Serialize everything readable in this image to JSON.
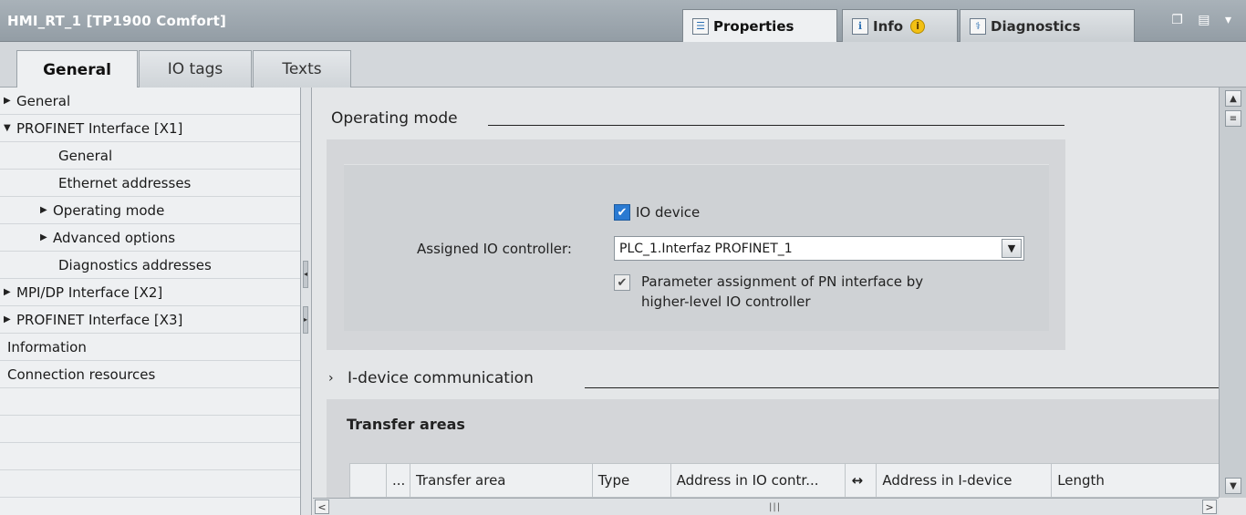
{
  "window": {
    "title": "HMI_RT_1 [TP1900 Comfort]",
    "controls": "❐ ▤ ▾"
  },
  "panel_tabs": [
    {
      "label": "Properties",
      "icon": "properties-icon",
      "glyph": "☰"
    },
    {
      "label": "Info",
      "icon": "info-list-icon",
      "glyph": "ℹ",
      "badge": "i"
    },
    {
      "label": "Diagnostics",
      "icon": "diagnostics-icon",
      "glyph": "⚕"
    }
  ],
  "subtabs": [
    "General",
    "IO tags",
    "Texts"
  ],
  "tree": [
    {
      "label": "General",
      "arrow": "▶",
      "indent": 0
    },
    {
      "label": "PROFINET Interface [X1]",
      "arrow": "▼",
      "indent": 0
    },
    {
      "label": "General",
      "arrow": "",
      "indent": 2
    },
    {
      "label": "Ethernet addresses",
      "arrow": "",
      "indent": 2
    },
    {
      "label": "Operating mode",
      "arrow": "▶",
      "indent": 1
    },
    {
      "label": "Advanced options",
      "arrow": "▶",
      "indent": 1
    },
    {
      "label": "Diagnostics addresses",
      "arrow": "",
      "indent": 2
    },
    {
      "label": "MPI/DP Interface [X2]",
      "arrow": "▶",
      "indent": 0
    },
    {
      "label": "PROFINET Interface [X3]",
      "arrow": "▶",
      "indent": 0
    },
    {
      "label": "Information",
      "arrow": "",
      "indent": 0
    },
    {
      "label": "Connection resources",
      "arrow": "",
      "indent": 0
    }
  ],
  "operating_mode": {
    "title": "Operating mode",
    "io_device_label": "IO device",
    "io_device_checked": true,
    "assigned_controller_label": "Assigned IO controller:",
    "assigned_controller_value": "PLC_1.Interfaz PROFINET_1",
    "param_assignment_line1": "Parameter assignment of PN interface by",
    "param_assignment_line2": "higher-level IO controller",
    "param_assignment_checked": true
  },
  "idevice": {
    "chevron": "›",
    "title": "I-device communication",
    "transfer_areas_title": "Transfer areas",
    "columns": [
      "",
      "...",
      "Transfer area",
      "Type",
      "Address in IO contr...",
      "↔",
      "Address in I-device",
      "Length"
    ]
  },
  "scroll": {
    "up": "▲",
    "down": "▼",
    "left": "<",
    "right": ">",
    "thumb": "|||",
    "grip": "≡"
  }
}
